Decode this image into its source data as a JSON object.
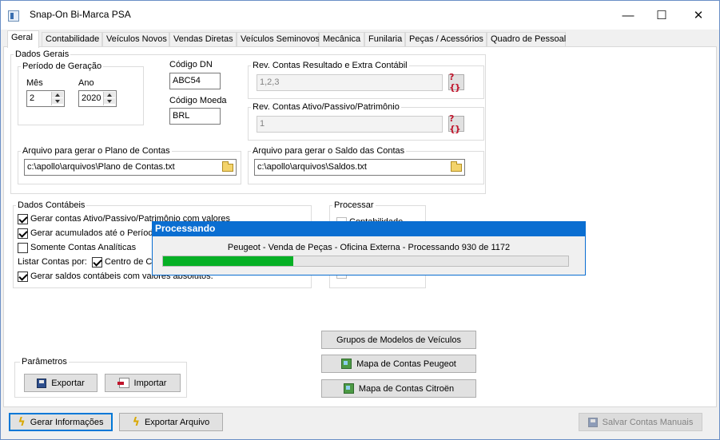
{
  "window": {
    "title": "Snap-On Bi-Marca PSA",
    "minimize": "—",
    "maximize": "☐",
    "close": "✕"
  },
  "tabs": [
    "Geral",
    "Contabilidade",
    "Veículos Novos",
    "Vendas Diretas",
    "Veículos Seminovos",
    "Mecânica",
    "Funilaria",
    "Peças / Acessórios",
    "Quadro de Pessoal"
  ],
  "dados_gerais": {
    "title": "Dados Gerais",
    "periodo": {
      "title": "Período de Geração",
      "mes_label": "Mês",
      "mes_value": "2",
      "ano_label": "Ano",
      "ano_value": "2020"
    },
    "codigo_dn": {
      "label": "Código DN",
      "value": "ABC54"
    },
    "codigo_moeda": {
      "label": "Código Moeda",
      "value": "BRL"
    },
    "rev_resultado": {
      "label": "Rev. Contas Resultado e Extra Contábil",
      "value": "1,2,3"
    },
    "rev_ativo": {
      "label": "Rev. Contas Ativo/Passivo/Patrimônio",
      "value": "1"
    },
    "plano_contas": {
      "label": "Arquivo para gerar o Plano de Contas",
      "value": "c:\\apollo\\arquivos\\Plano de Contas.txt"
    },
    "saldo_contas": {
      "label": "Arquivo para gerar o Saldo das Contas",
      "value": "c:\\apollo\\arquivos\\Saldos.txt"
    },
    "help_icon": "?{}"
  },
  "dados_contabeis": {
    "title": "Dados Contábeis",
    "opt1": "Gerar contas Ativo/Passivo/Patrimônio com valores",
    "opt2": "Gerar acumulados até o Período",
    "opt3": "Somente Contas Analíticas",
    "listar_label": "Listar Contas por:",
    "listar_opt": "Centro de Cu",
    "opt4": "Gerar saldos contábeis com valores absolutos."
  },
  "processar": {
    "title": "Processar",
    "opt1": "Contabilidade"
  },
  "parametros": {
    "title": "Parâmetros",
    "exportar": "Exportar",
    "importar": "Importar"
  },
  "model_buttons": {
    "grupos": "Grupos de Modelos de Veículos",
    "peugeot": "Mapa de Contas Peugeot",
    "citroen": "Mapa de Contas Citroën"
  },
  "bottom": {
    "gerar": "Gerar Informações",
    "exportar_arquivo": "Exportar Arquivo",
    "salvar": "Salvar Contas Manuais"
  },
  "dialog": {
    "title": "Processando",
    "message": "Peugeot - Venda de Peças - Oficina Externa - Processando 930 de 1172",
    "progress_current": 930,
    "progress_total": 1172
  },
  "colors": {
    "accent": "#0a6ed1",
    "progress": "#06b025"
  }
}
